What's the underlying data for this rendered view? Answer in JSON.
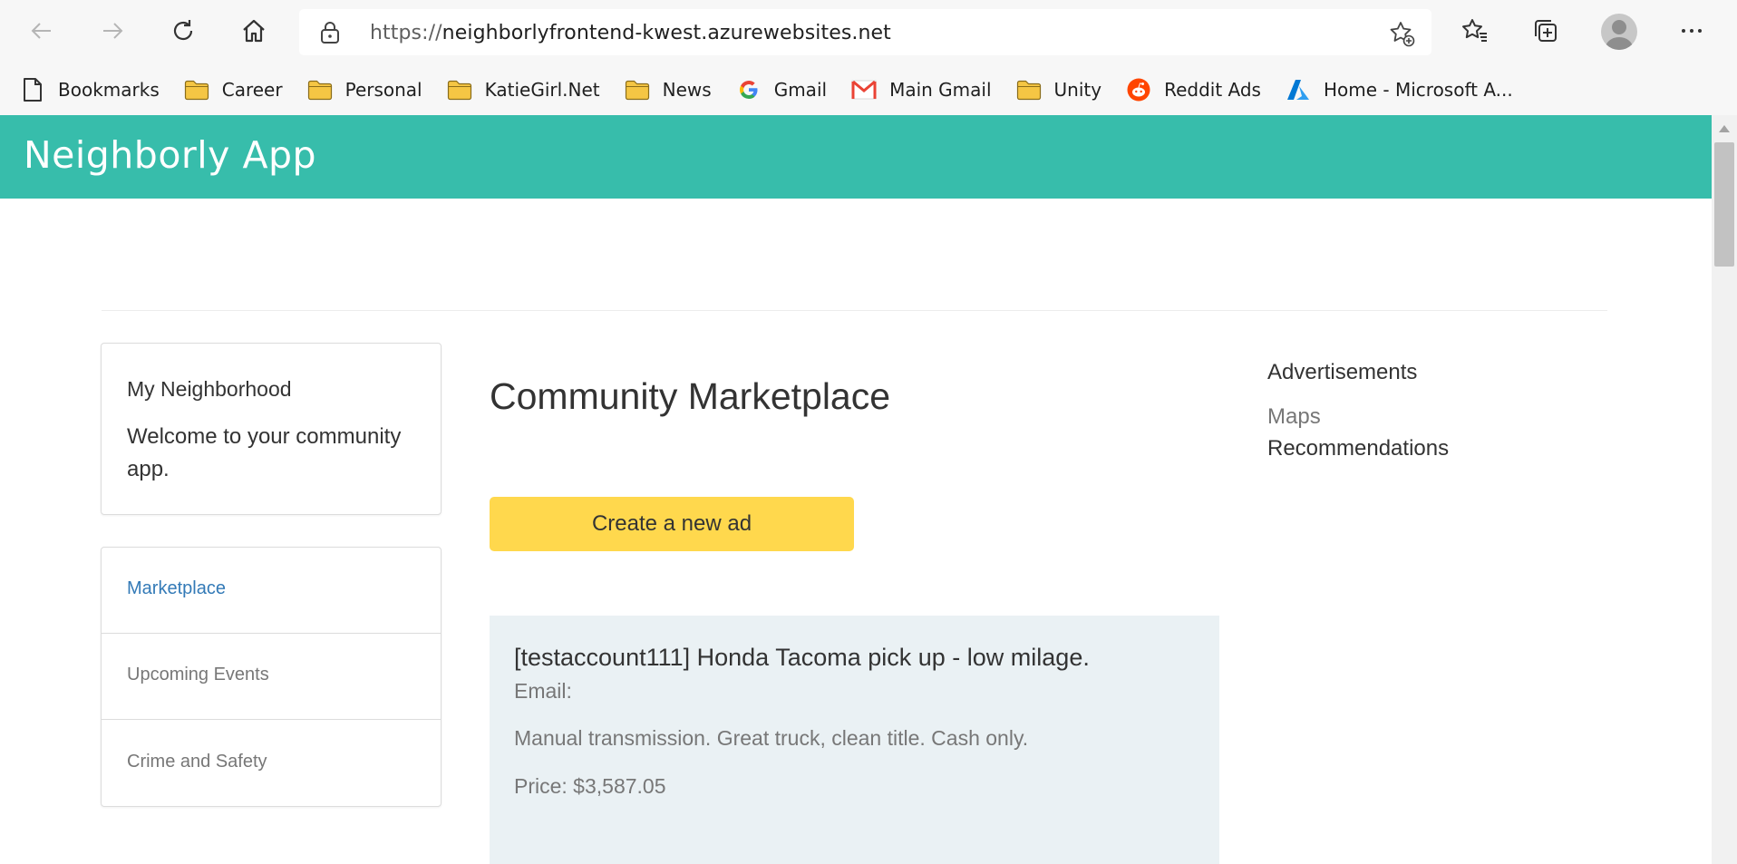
{
  "browser": {
    "url_protocol": "https://",
    "url_host": "neighborlyfrontend-kwest.azurewebsites.net",
    "bookmarks": [
      {
        "label": "Bookmarks",
        "icon": "page-icon"
      },
      {
        "label": "Career",
        "icon": "folder-icon"
      },
      {
        "label": "Personal",
        "icon": "folder-icon"
      },
      {
        "label": "KatieGirl.Net",
        "icon": "folder-icon"
      },
      {
        "label": "News",
        "icon": "folder-icon"
      },
      {
        "label": "Gmail",
        "icon": "google-icon"
      },
      {
        "label": "Main Gmail",
        "icon": "gmail-icon"
      },
      {
        "label": "Unity",
        "icon": "folder-icon"
      },
      {
        "label": "Reddit Ads",
        "icon": "reddit-icon"
      },
      {
        "label": "Home - Microsoft A...",
        "icon": "azure-icon"
      }
    ],
    "colors": {
      "folder": "#f5c644",
      "accent_gmail": "#ea4335",
      "reddit": "#ff4500",
      "azure": "#0078d4"
    }
  },
  "app": {
    "brand": "Neighborly App",
    "header_color": "#37bdab"
  },
  "sidebar": {
    "card_title": "My Neighborhood",
    "card_text": "Welcome to your community app.",
    "nav": [
      {
        "label": "Marketplace",
        "active": true
      },
      {
        "label": "Upcoming Events",
        "active": false
      },
      {
        "label": "Crime and Safety",
        "active": false
      }
    ]
  },
  "main": {
    "title": "Community Marketplace",
    "create_button": "Create a new ad",
    "create_button_color": "#ffd84d",
    "listings": [
      {
        "title": "[testaccount111] Honda Tacoma pick up - low milage.",
        "email": "Email:",
        "description": "Manual transmission. Great truck, clean title. Cash only.",
        "price": "Price: $3,587.05"
      }
    ]
  },
  "right": {
    "title": "Advertisements",
    "links": [
      "Maps",
      "Recommendations"
    ]
  }
}
